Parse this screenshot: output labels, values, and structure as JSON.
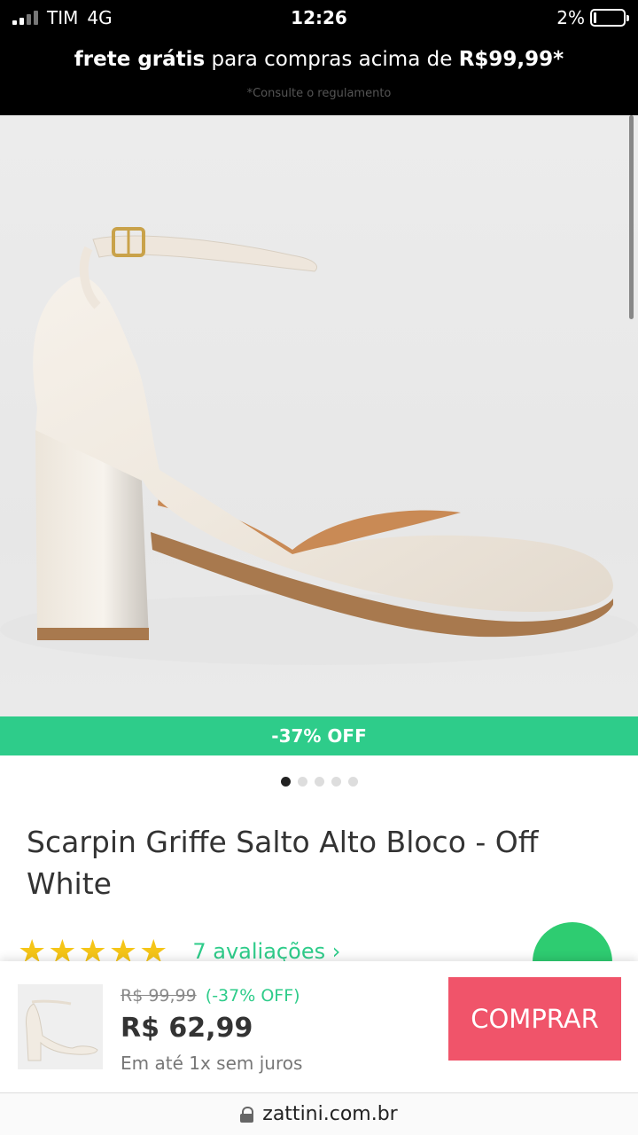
{
  "status_bar": {
    "carrier": "TIM",
    "network": "4G",
    "time": "12:26",
    "battery": "2%"
  },
  "promo": {
    "bold_start": "frete grátis",
    "middle": " para compras acima de ",
    "bold_end": "R$99,99*",
    "note": "*Consulte o regulamento"
  },
  "product": {
    "discount_badge": "-37% OFF",
    "title": "Scarpin Griffe Salto Alto Bloco - Off White",
    "rating_stars": "★★★★★",
    "reviews": "7 avaliações  ›",
    "carousel_dots": 5
  },
  "buy_bar": {
    "old_price": "R$ 99,99",
    "discount": "(-37% OFF)",
    "price": "R$ 62,99",
    "installments": "Em até 1x sem juros",
    "button_label": "COMPRAR"
  },
  "browser": {
    "url": "zattini.com.br"
  },
  "colors": {
    "accent_green": "#2ecc8a",
    "buy_red": "#f0546a",
    "star_yellow": "#f5c518"
  },
  "icons": [
    "signal-icon",
    "battery-icon",
    "lock-icon",
    "whatsapp-icon"
  ]
}
